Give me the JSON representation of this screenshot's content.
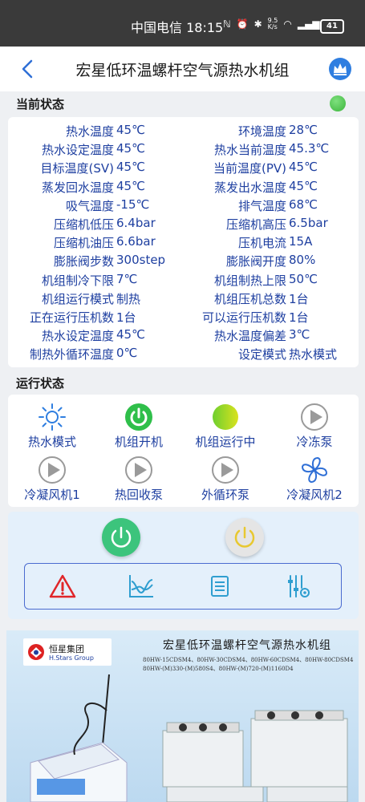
{
  "status_bar": {
    "carrier_time": "中国电信 18:15",
    "speed": "9.5\nK/s",
    "battery": "41"
  },
  "header": {
    "title": "宏星低环温螺杆空气源热水机组"
  },
  "current_status": {
    "section_label": "当前状态",
    "indicator_color": "#4cc24c",
    "rows": [
      {
        "l1": "热水温度",
        "v1": "45℃",
        "l2": "环境温度",
        "v2": "28℃"
      },
      {
        "l1": "热水设定温度",
        "v1": "45℃",
        "l2": "热水当前温度",
        "v2": "45.3℃"
      },
      {
        "l1": "目标温度(SV)",
        "v1": "45℃",
        "l2": "当前温度(PV)",
        "v2": "45℃"
      },
      {
        "l1": "蒸发回水温度",
        "v1": "45℃",
        "l2": "蒸发出水温度",
        "v2": "45℃"
      },
      {
        "l1": "吸气温度",
        "v1": "-15℃",
        "l2": "排气温度",
        "v2": "68℃"
      },
      {
        "l1": "压缩机低压",
        "v1": "6.4bar",
        "l2": "压缩机高压",
        "v2": "6.5bar"
      },
      {
        "l1": "压缩机油压",
        "v1": "6.6bar",
        "l2": "压机电流",
        "v2": "15A"
      },
      {
        "l1": "膨胀阀步数",
        "v1": "300step",
        "l2": "膨胀阀开度",
        "v2": "80%"
      },
      {
        "l1": "机组制冷下限",
        "v1": "7℃",
        "l2": "机组制热上限",
        "v2": "50℃"
      },
      {
        "l1": "机组运行模式",
        "v1": "制热",
        "l2": "机组压机总数",
        "v2": "1台"
      },
      {
        "l1": "正在运行压机数",
        "v1": "1台",
        "l2": "可以运行压机数",
        "v2": "1台"
      },
      {
        "l1": "热水设定温度",
        "v1": "45℃",
        "l2": "热水温度偏差",
        "v2": "3℃"
      },
      {
        "l1": "制热外循环温度",
        "v1": "0℃",
        "l2": "设定模式",
        "v2": "热水模式"
      }
    ]
  },
  "run_status": {
    "section_label": "运行状态",
    "items": [
      {
        "label": "热水模式",
        "icon": "sun-icon"
      },
      {
        "label": "机组开机",
        "icon": "power-on-icon"
      },
      {
        "label": "机组运行中",
        "icon": "running-ball-icon"
      },
      {
        "label": "冷冻泵",
        "icon": "play-icon"
      },
      {
        "label": "冷凝风机1",
        "icon": "play-icon"
      },
      {
        "label": "热回收泵",
        "icon": "play-icon"
      },
      {
        "label": "外循环泵",
        "icon": "play-icon"
      },
      {
        "label": "冷凝风机2",
        "icon": "fan-icon"
      }
    ]
  },
  "controls": {
    "power_on_color": "#3cc47c",
    "power_off_color": "#e5e5e5",
    "tools": [
      "alarm-icon",
      "chart-icon",
      "list-icon",
      "settings-sliders-icon"
    ]
  },
  "banner": {
    "title": "宏星低环温螺杆空气源热水机组",
    "models_line1": "80HW-15CDSM4、80HW-30CDSM4、80HW-60CDSM4、80HW-80CDSM4",
    "models_line2": "80HW-(M)330-(M)580S4、80HW-(M)720-(M)1160D4",
    "logo_name": "恒星集团",
    "logo_sub": "H.Stars Group"
  }
}
